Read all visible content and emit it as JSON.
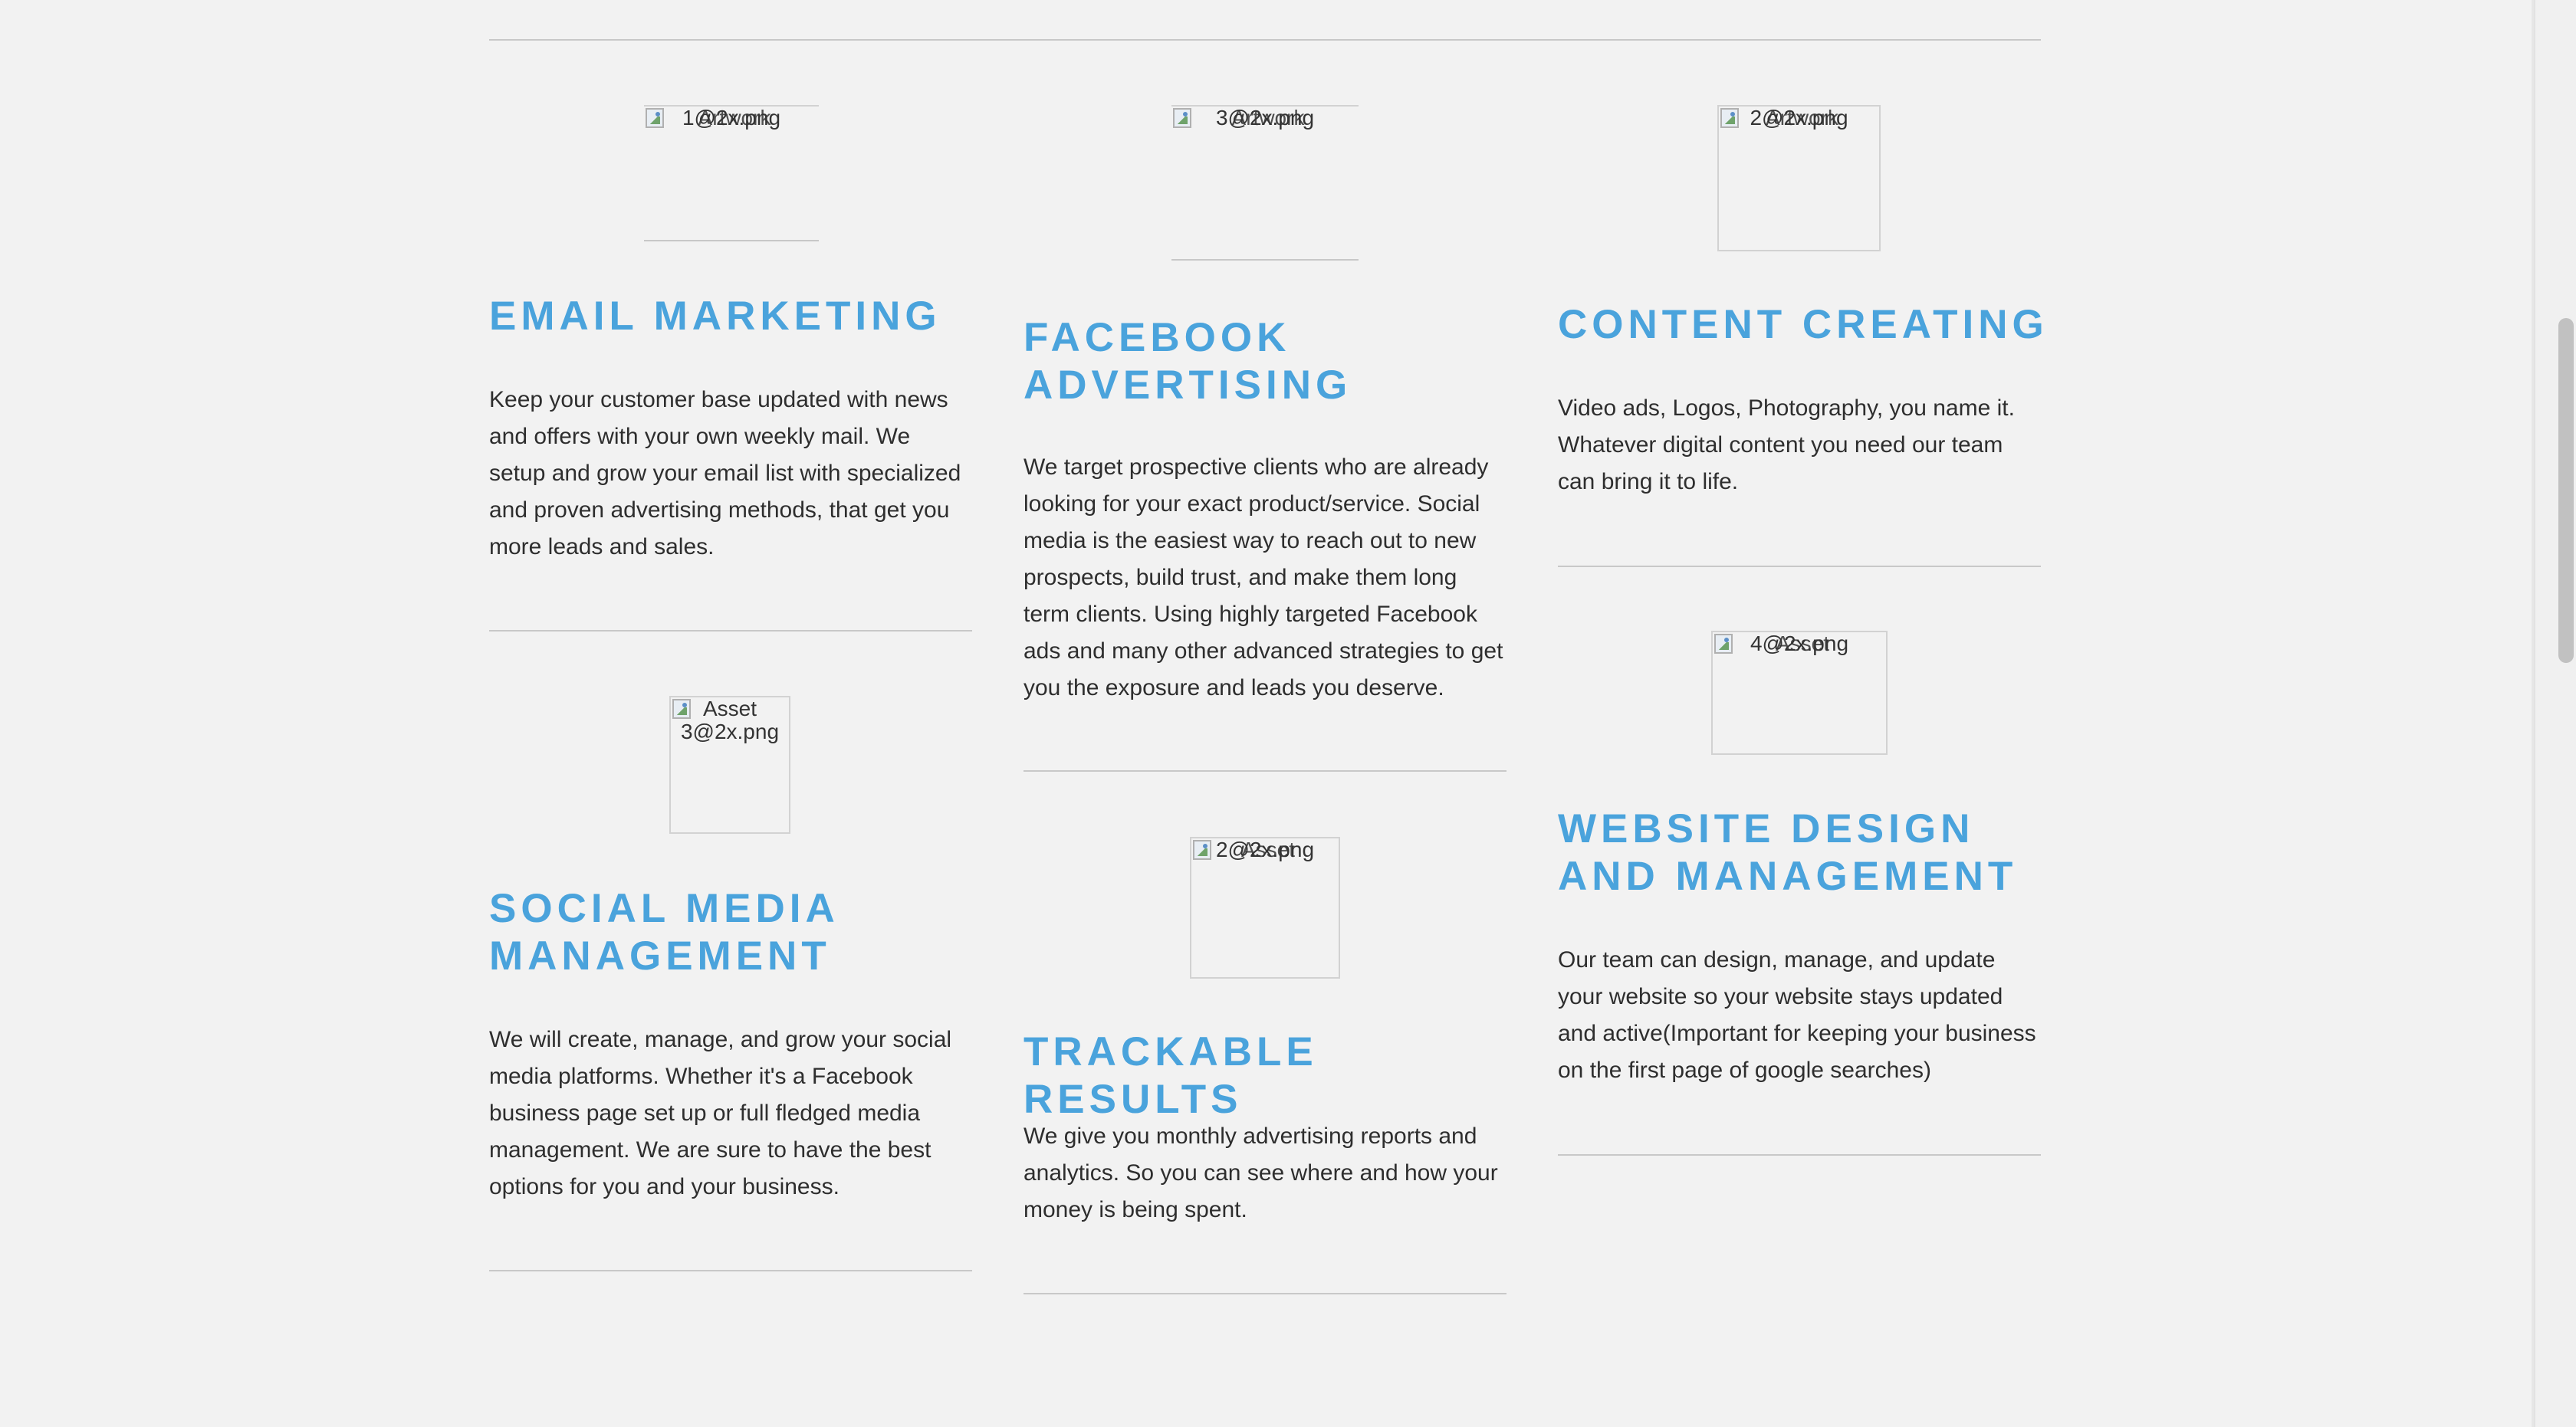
{
  "services": {
    "email": {
      "img_alt": "1@2x.png",
      "img_alt_overlap": "Artwork",
      "title": "EMAIL MARKETING",
      "description": "Keep your customer base updated with news and offers with your own weekly mail. We setup and grow your email list with specialized and proven advertising methods, that get you more leads and sales."
    },
    "facebook": {
      "img_alt": "3@2x.png",
      "img_alt_overlap": "Artwork",
      "title": "FACEBOOK ADVERTISING",
      "description": "We target prospective clients who are already looking for your exact product/service. Social media is the easiest way to reach out to new prospects, build trust, and make them long term clients. Using highly targeted Facebook ads and many other advanced strategies to get you the exposure and leads you deserve."
    },
    "content": {
      "img_alt": "2@2x.png",
      "img_alt_overlap": "Artwork",
      "title": "CONTENT CREATING",
      "description": "Video ads, Logos, Photography, you name it. Whatever digital content you need our team can bring it to life."
    },
    "social": {
      "img_alt": "Asset 3@2x.png",
      "title": "SOCIAL MEDIA MANAGEMENT",
      "description": "We will create, manage, and grow your social media platforms. Whether it's a Facebook business page set up or full fledged media management. We are sure to have the best options for you and your business."
    },
    "trackable": {
      "img_alt": "2@2x.png",
      "img_alt_overlap": "Asset",
      "title": "TRACKABLE RESULTS",
      "description": "We give you monthly advertising reports and analytics. So you can see where and how your money is being spent."
    },
    "website": {
      "img_alt": "4@2x.png",
      "img_alt_overlap": "Asset",
      "title": "WEBSITE DESIGN AND MANAGEMENT",
      "description": "Our team can design, manage, and update your website so your website stays updated and active(Important for keeping your business on the first page of google searches)"
    }
  },
  "colors": {
    "accent": "#4aa3dc",
    "background": "#f2f2f2",
    "text": "#2e2e2e",
    "rule": "#c8c8c8"
  }
}
